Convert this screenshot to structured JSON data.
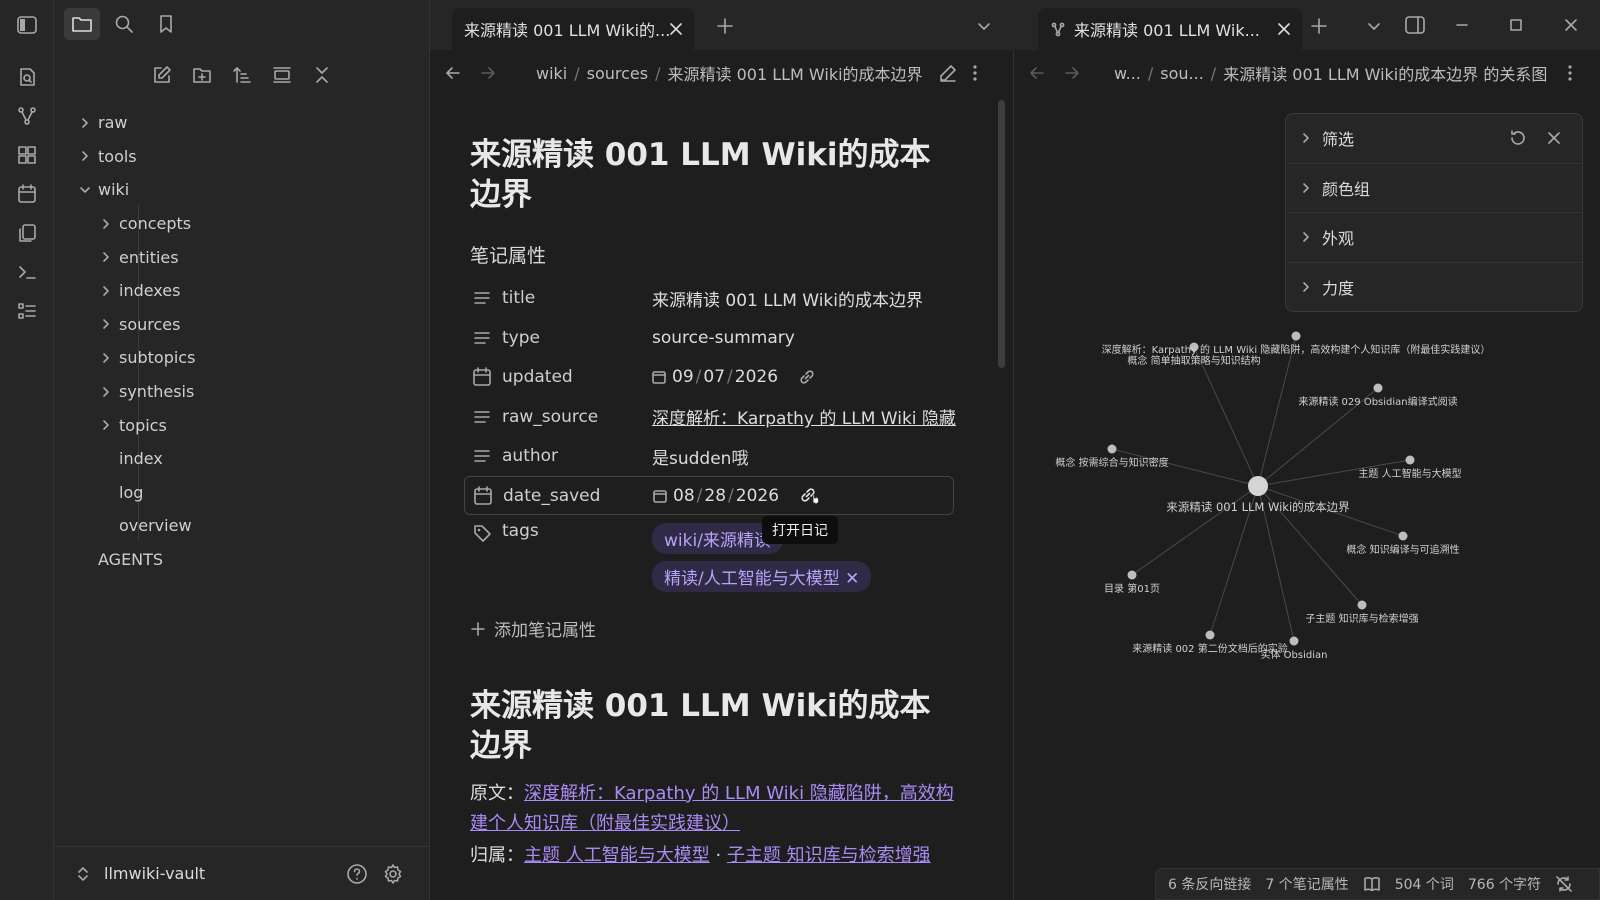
{
  "sidebar": {
    "tree": [
      {
        "label": "raw",
        "type": "folder"
      },
      {
        "label": "tools",
        "type": "folder"
      },
      {
        "label": "wiki",
        "type": "folder-open"
      },
      {
        "label": "concepts",
        "type": "folder"
      },
      {
        "label": "entities",
        "type": "folder"
      },
      {
        "label": "indexes",
        "type": "folder"
      },
      {
        "label": "sources",
        "type": "folder"
      },
      {
        "label": "subtopics",
        "type": "folder"
      },
      {
        "label": "synthesis",
        "type": "folder"
      },
      {
        "label": "topics",
        "type": "folder"
      },
      {
        "label": "index",
        "type": "file"
      },
      {
        "label": "log",
        "type": "file"
      },
      {
        "label": "overview",
        "type": "file"
      },
      {
        "label": "AGENTS",
        "type": "file"
      }
    ],
    "vault_name": "llmwiki-vault"
  },
  "left_pane": {
    "tab_title": "来源精读 001 LLM Wiki的...",
    "breadcrumb": [
      "wiki",
      "sources",
      "来源精读 001 LLM Wiki的成本边界"
    ],
    "note_title": "来源精读 001 LLM Wiki的成本边界",
    "properties_heading": "笔记属性",
    "properties": {
      "title": {
        "key": "title",
        "value": "来源精读 001 LLM Wiki的成本边界"
      },
      "type": {
        "key": "type",
        "value": "source-summary"
      },
      "updated": {
        "key": "updated",
        "month": "09",
        "day": "07",
        "year": "2026"
      },
      "raw_source": {
        "key": "raw_source",
        "value": "深度解析：Karpathy 的 LLM Wiki 隐藏"
      },
      "author": {
        "key": "author",
        "value": "是sudden哦"
      },
      "date_saved": {
        "key": "date_saved",
        "month": "08",
        "day": "28",
        "year": "2026"
      },
      "tags": {
        "key": "tags",
        "tag1": "wiki/来源精读",
        "tag2": "精读/人工智能与大模型"
      }
    },
    "tooltip": "打开日记",
    "add_property": "添加笔记属性",
    "body_heading": "来源精读 001 LLM Wiki的成本边界",
    "body": {
      "source_label": "原文：",
      "source_link": "深度解析：Karpathy 的 LLM Wiki 隐藏陷阱，高效构建个人知识库（附最佳实践建议）",
      "belongs_label": "归属：",
      "belongs_link1": "主题 人工智能与大模型",
      "belongs_sep": " · ",
      "belongs_link2": "子主题 知识库与检索增强"
    }
  },
  "right_pane": {
    "tab_title": "来源精读 001 LLM Wik...",
    "breadcrumb": [
      "w...",
      "sou...",
      "来源精读 001 LLM Wiki的成本边界 的关系图"
    ],
    "graph_controls": [
      "筛选",
      "颜色组",
      "外观",
      "力度"
    ],
    "graph_nodes": [
      {
        "id": "center",
        "label": "来源精读 001 LLM Wiki的成本边界"
      },
      {
        "id": "n1",
        "label": "概念 简单抽取策略与知识结构"
      },
      {
        "id": "n2",
        "label": "深度解析：Karpathy 的 LLM Wiki 隐藏陷阱，高效构建个人知识库（附最佳实践建议）"
      },
      {
        "id": "n3",
        "label": "来源精读 029 Obsidian编译式阅读"
      },
      {
        "id": "n4",
        "label": "概念 按需综合与知识密度"
      },
      {
        "id": "n5",
        "label": "主题 人工智能与大模型"
      },
      {
        "id": "n6",
        "label": "概念 知识编译与可追溯性"
      },
      {
        "id": "n7",
        "label": "目录 第01页"
      },
      {
        "id": "n8",
        "label": "子主题 知识库与检索增强"
      },
      {
        "id": "n9",
        "label": "来源精读 002 第二份文档后的实验"
      },
      {
        "id": "n10",
        "label": "实体 Obsidian"
      }
    ],
    "status": {
      "backlinks": "6 条反向链接",
      "properties": "7 个笔记属性",
      "words": "504 个词",
      "chars": "766 个字符"
    }
  }
}
